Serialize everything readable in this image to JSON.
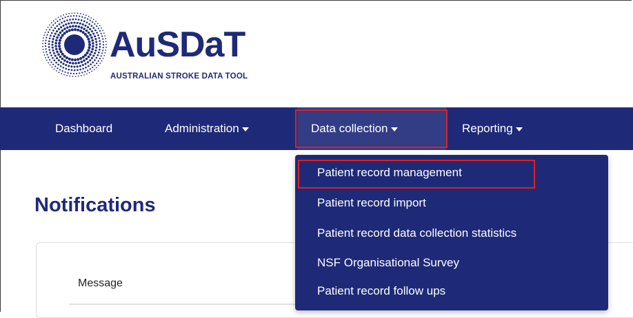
{
  "brand": {
    "name": "AuSDaT",
    "tagline": "AUSTRALIAN STROKE DATA TOOL"
  },
  "nav": {
    "items": [
      {
        "label": "Dashboard"
      },
      {
        "label": "Administration"
      },
      {
        "label": "Data collection"
      },
      {
        "label": "Reporting"
      }
    ]
  },
  "dropdown": {
    "items": [
      {
        "label": "Patient record management"
      },
      {
        "label": "Patient record import"
      },
      {
        "label": "Patient record data collection statistics"
      },
      {
        "label": "NSF Organisational Survey"
      },
      {
        "label": "Patient record follow ups"
      }
    ]
  },
  "main": {
    "title": "Notifications",
    "table": {
      "columns": [
        "Message"
      ]
    }
  },
  "colors": {
    "primary": "#1e2a78",
    "highlight": "#e0201f",
    "active_nav": "#323d86"
  },
  "icons": {
    "logo": "dotted-ring-logo-icon",
    "caret": "caret-down-icon"
  }
}
